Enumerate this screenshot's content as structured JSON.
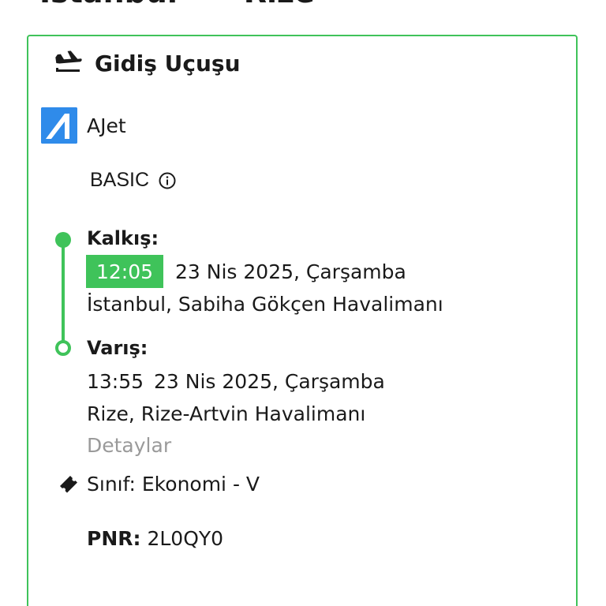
{
  "header": {
    "origin": "İstanbul",
    "arrow": "→",
    "destination": "Rize"
  },
  "section": {
    "title": "Gidiş Uçuşu",
    "icon": "plane-departure-icon"
  },
  "airline": {
    "name": "AJet",
    "logo": "ajet-logo"
  },
  "fare": {
    "name": "BASIC",
    "icon": "info-icon"
  },
  "departure": {
    "label": "Kalkış:",
    "time": "12:05",
    "date": "23 Nis 2025, Çarşamba",
    "airport": "İstanbul, Sabiha Gökçen Havalimanı"
  },
  "arrival": {
    "label": "Varış:",
    "time": "13:55",
    "date": "23 Nis 2025, Çarşamba",
    "airport": "Rize, Rize-Artvin Havalimanı"
  },
  "details_link": "Detaylar",
  "cabin": {
    "icon": "ticket-icon",
    "text": "Sınıf: Ekonomi - V"
  },
  "pnr": {
    "label": "PNR:",
    "value": "2L0QY0"
  },
  "colors": {
    "accent": "#3fc35a",
    "airline_blue": "#2f8bea",
    "muted": "#9a9a9a"
  }
}
